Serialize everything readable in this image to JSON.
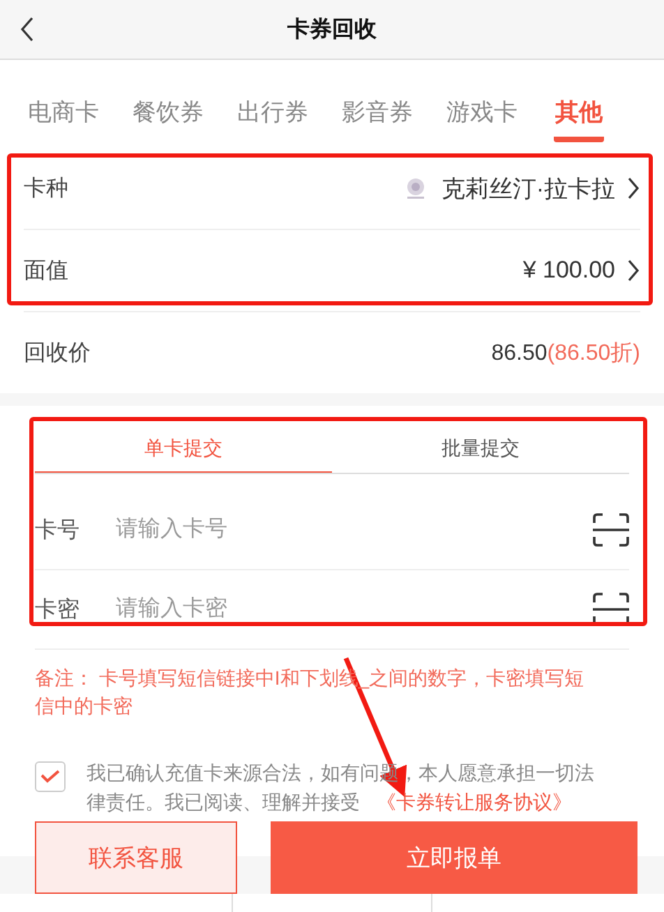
{
  "header": {
    "title": "卡券回收"
  },
  "category_tabs": [
    {
      "label": "电商卡",
      "selected": false
    },
    {
      "label": "餐饮券",
      "selected": false
    },
    {
      "label": "出行券",
      "selected": false
    },
    {
      "label": "影音券",
      "selected": false
    },
    {
      "label": "游戏卡",
      "selected": false
    },
    {
      "label": "其他",
      "selected": true
    }
  ],
  "options": [
    {
      "label": "卡种",
      "value": "克莉丝汀·拉卡拉",
      "kind": "brand"
    },
    {
      "label": "面值",
      "value": "¥ 100.00",
      "kind": "plain"
    }
  ],
  "price": {
    "label": "回收价",
    "amount": "86.50",
    "discount": "(86.50折)"
  },
  "submit_tabs": [
    {
      "label": "单卡提交",
      "selected": true
    },
    {
      "label": "批量提交",
      "selected": false
    }
  ],
  "fields": [
    {
      "label": "卡号",
      "placeholder": "请输入卡号"
    },
    {
      "label": "卡密",
      "placeholder": "请输入卡密"
    }
  ],
  "note": "备注： 卡号填写短信链接中I和下划线_之间的数字，卡密填写短信中的卡密",
  "agreement": {
    "checked": true,
    "text": "我已确认充值卡来源合法，如有问题，本人愿意承担一切法律责任。我已阅读、理解并接受 ",
    "link": "《卡券转让服务协议》"
  },
  "buttons": [
    {
      "label": "联系客服",
      "kind": "outline"
    },
    {
      "label": "立即报单",
      "kind": "primary"
    }
  ]
}
